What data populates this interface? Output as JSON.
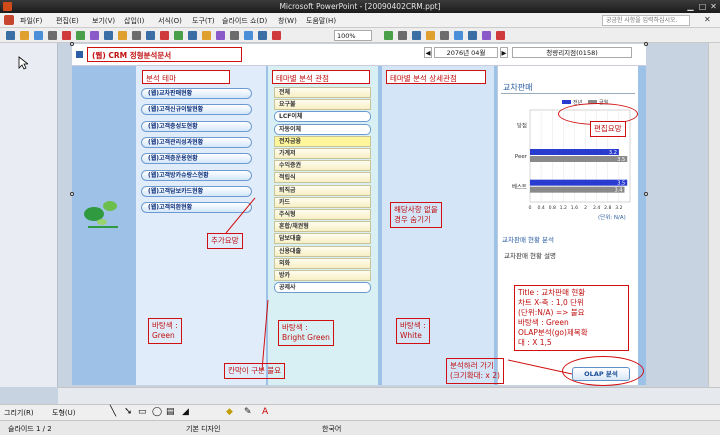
{
  "window": {
    "title": "Microsoft PowerPoint - [20090402CRM.ppt]"
  },
  "menu": {
    "items": [
      "파일(F)",
      "편집(E)",
      "보기(V)",
      "삽입(I)",
      "서식(O)",
      "도구(T)",
      "슬라이드 쇼(D)",
      "창(W)",
      "도움말(H)"
    ],
    "help_placeholder": "궁금한 사항을 입력하십시오."
  },
  "toolbar": {
    "zoom": "100%"
  },
  "slide": {
    "header_title": "(웹) CRM 정형분석문서",
    "year_month": "2076년 04월",
    "branch": "청량리지점(0158)",
    "col1": {
      "title": "분석 테마",
      "items": [
        "(웹)교차판매현황",
        "(웹)고객신규이탈현황",
        "(웹)고객충성도현황",
        "(웹)고객관리성과현황",
        "(웹)고객층운용현황",
        "(웹)고객방카슈랑스현황",
        "(웹)고객담보카드현황",
        "(웹)고객외환현황"
      ]
    },
    "col2": {
      "title": "테마별 분석 관점",
      "items": [
        "전체",
        "요구불",
        "LCF이체",
        "자동이체",
        "전자금융",
        "가계저",
        "수익증권",
        "적립식",
        "퇴직금",
        "카드",
        "주식형",
        "혼합/채권형",
        "담보대출",
        "신용대출",
        "외화",
        "방카",
        "공제사"
      ],
      "selected": [
        2,
        3,
        16
      ],
      "highlight": [
        4
      ]
    },
    "col3": {
      "title": "테마별 분석 상세관점"
    },
    "notes": {
      "add_needed": "추가요망",
      "bg_green": "바탕색 :\nGreen",
      "bg_bright": "바탕색 :\nBright Green",
      "bg_white": "바탕색 :\nWhite",
      "divider": "칸막이 구분 불요",
      "hide_if_none": "해당사항 없을\n경우 숨기기",
      "edit_needed": "편집요망",
      "detail_note": "Title : 교차판매 현황\n차트 X-축 : 1,0 단위\n(단위:N/A) => 불요\n바탕색 : Green\nOLAP분석(go)제목확\n대 : X 1,5",
      "olap_note": "분석하러 가기\n(크기확대: x 2)"
    },
    "panel": {
      "title": "교차판매",
      "subtitle": "교차판매 현황 분석",
      "body": "교차판매 현황 설명",
      "unit": "(단위: N/A)",
      "olap_button": "OLAP 분석"
    }
  },
  "chart_data": {
    "type": "bar",
    "orientation": "horizontal",
    "categories": [
      "당점",
      "Peer",
      "베스트"
    ],
    "series": [
      {
        "name": "전년",
        "color": "#2a3bd0",
        "values": [
          0,
          3.2,
          3.5
        ]
      },
      {
        "name": "금월",
        "color": "#8a8a8a",
        "values": [
          0,
          3.5,
          3.4
        ]
      }
    ],
    "xticks": [
      "0",
      "0.4",
      "0.8",
      "1.2",
      "1.6",
      "2",
      "2.4",
      "2.8",
      "3.2"
    ],
    "xlim": [
      0,
      3.6
    ],
    "legend_position": "top",
    "grid": true
  },
  "status": {
    "slide": "슬라이드 1 / 2",
    "design": "기본 디자인",
    "lang": "한국어"
  },
  "drawbar": {
    "draw": "그리기(R)",
    "shapes": "도형(U)"
  }
}
